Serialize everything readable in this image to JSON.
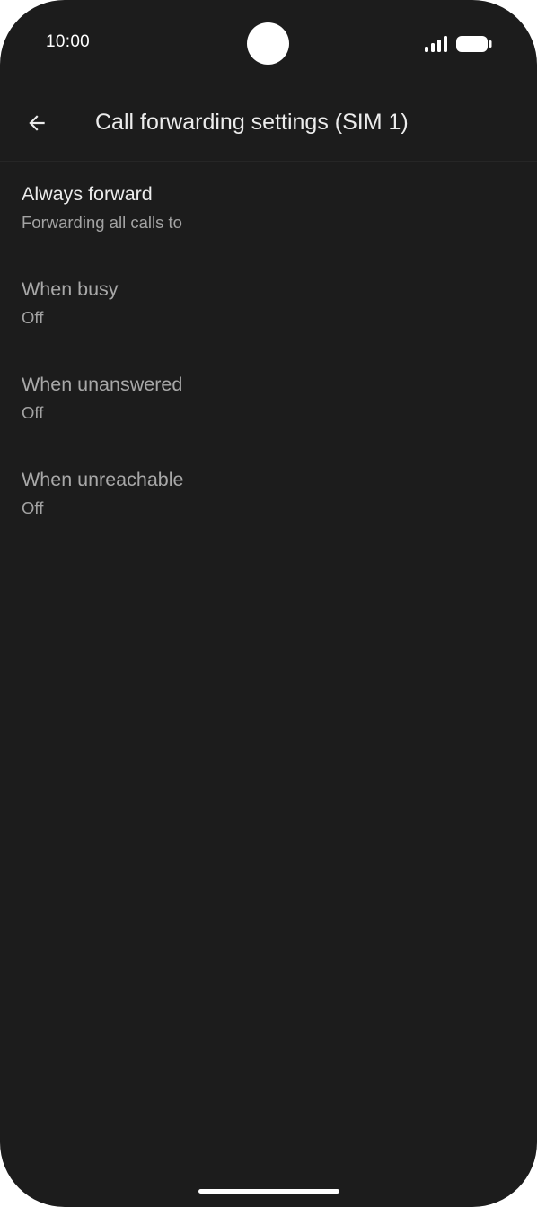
{
  "status_bar": {
    "time": "10:00",
    "signal_icon": "cellular-signal-icon",
    "battery_icon": "battery-full-icon"
  },
  "app_bar": {
    "back_icon": "arrow-back-icon",
    "title": "Call forwarding settings (SIM 1)"
  },
  "settings": {
    "items": [
      {
        "title": "Always forward",
        "summary": "Forwarding all calls to"
      },
      {
        "title": "When busy",
        "summary": "Off"
      },
      {
        "title": "When unanswered",
        "summary": "Off"
      },
      {
        "title": "When unreachable",
        "summary": "Off"
      }
    ]
  },
  "colors": {
    "background": "#1c1c1c",
    "primary_text": "#ececec",
    "secondary_text": "#a3a3a3"
  }
}
